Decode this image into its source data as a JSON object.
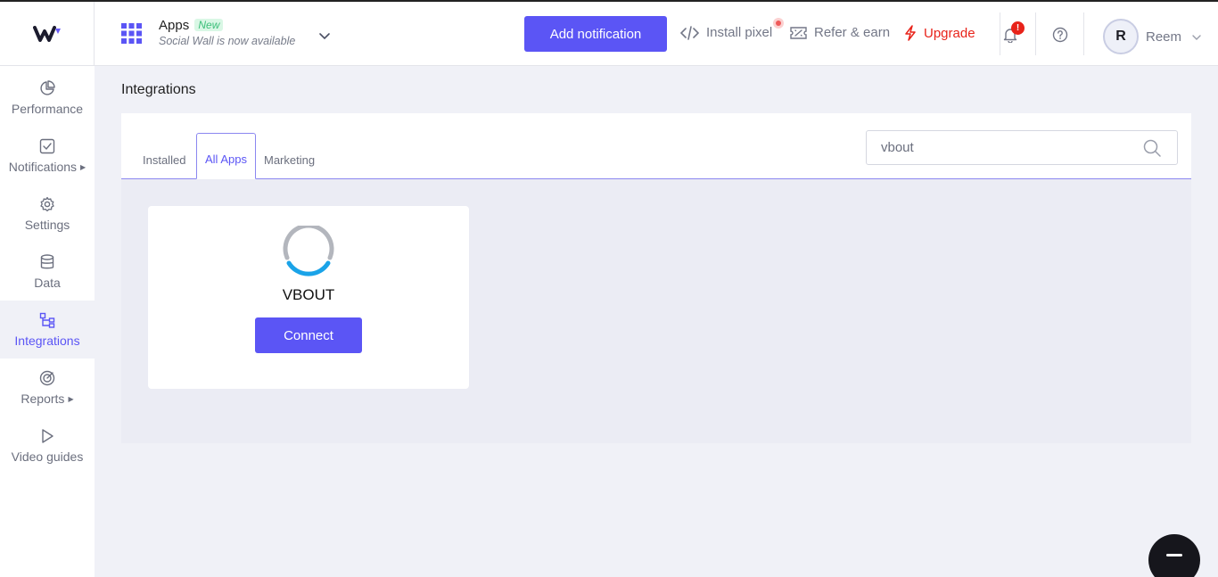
{
  "topbar": {
    "apps_title": "Apps",
    "apps_badge": "New",
    "apps_subtitle": "Social Wall is now available",
    "add_notification": "Add notification",
    "install_pixel": "Install pixel",
    "refer_earn": "Refer & earn",
    "upgrade": "Upgrade",
    "notification_count": "!",
    "user_initial": "R",
    "user_name": "Reem"
  },
  "sidebar": {
    "items": [
      {
        "label": "Performance",
        "icon": "pie-chart-icon"
      },
      {
        "label": "Notifications",
        "icon": "check-square-icon"
      },
      {
        "label": "Settings",
        "icon": "gear-icon"
      },
      {
        "label": "Data",
        "icon": "database-icon"
      },
      {
        "label": "Integrations",
        "icon": "integrations-icon",
        "active": true
      },
      {
        "label": "Reports",
        "icon": "target-icon"
      },
      {
        "label": "Video guides",
        "icon": "play-icon"
      }
    ]
  },
  "main": {
    "title": "Integrations",
    "tabs": [
      {
        "label": "Installed"
      },
      {
        "label": "All Apps",
        "active": true
      },
      {
        "label": "Marketing"
      }
    ],
    "search": {
      "value": "vbout"
    },
    "cards": [
      {
        "name": "VBOUT",
        "button": "Connect"
      }
    ]
  },
  "colors": {
    "accent": "#5b55f5",
    "upgrade": "#e8231a",
    "background": "#f0f1f7"
  }
}
